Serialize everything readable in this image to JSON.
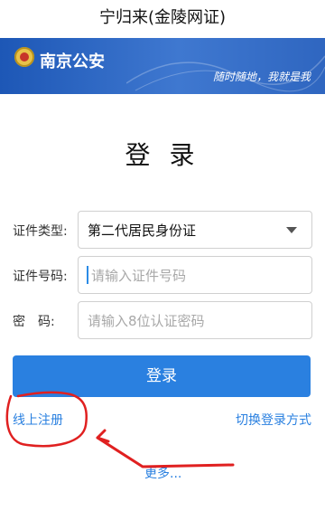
{
  "window": {
    "title": "宁归来(金陵网证)"
  },
  "header": {
    "brand": "南京公安",
    "slogan": "随时随地，我就是我"
  },
  "login": {
    "title": "登 录",
    "id_type_label": "证件类型:",
    "id_type_value": "第二代居民身份证",
    "id_number_label": "证件号码:",
    "id_number_placeholder": "请输入证件号码",
    "password_label": "密　码:",
    "password_placeholder": "请输入8位认证密码",
    "submit_label": "登录",
    "register_link": "线上注册",
    "switch_login_link": "切换登录方式",
    "more_link": "更多..."
  },
  "colors": {
    "banner": "#2f66c0",
    "primary": "#2a80e0",
    "annotation": "#e02020"
  }
}
